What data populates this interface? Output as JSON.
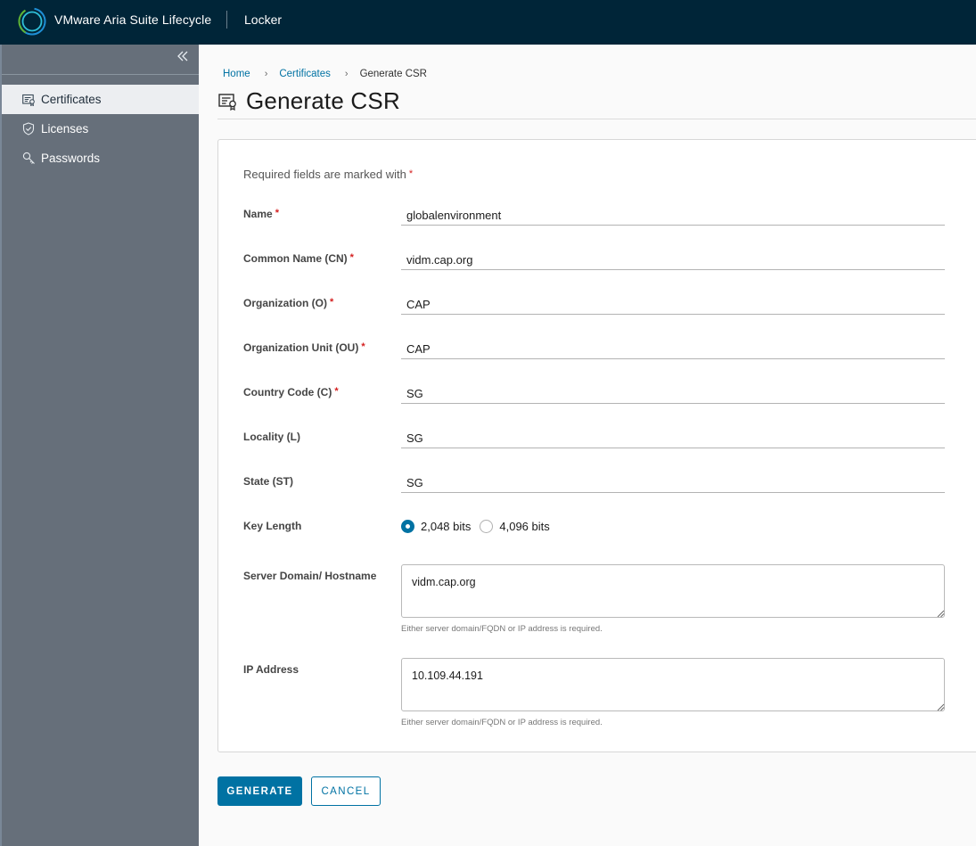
{
  "header": {
    "app_title": "VMware Aria Suite Lifecycle",
    "section": "Locker",
    "logo_icon": "vmware-aria-ring-logo"
  },
  "sidebar": {
    "collapse_glyph": "«",
    "items": [
      {
        "label": "Certificates",
        "icon": "certificate-icon",
        "active": true
      },
      {
        "label": "Licenses",
        "icon": "shield-check-icon",
        "active": false
      },
      {
        "label": "Passwords",
        "icon": "key-icon",
        "active": false
      }
    ]
  },
  "breadcrumb": {
    "items": [
      "Home",
      "Certificates",
      "Generate CSR"
    ],
    "separator": "›"
  },
  "page": {
    "title": "Generate CSR",
    "title_icon": "certificate-icon"
  },
  "form": {
    "required_note": "Required fields are marked with",
    "required_marker": "*",
    "fields": [
      {
        "label": "Name",
        "required": true,
        "value": "globalenvironment"
      },
      {
        "label": "Common Name (CN)",
        "required": true,
        "value": "vidm.cap.org"
      },
      {
        "label": "Organization (O)",
        "required": true,
        "value": "CAP"
      },
      {
        "label": "Organization Unit (OU)",
        "required": true,
        "value": "CAP"
      },
      {
        "label": "Country Code (C)",
        "required": true,
        "value": "SG"
      },
      {
        "label": "Locality (L)",
        "required": false,
        "value": "SG"
      },
      {
        "label": "State (ST)",
        "required": false,
        "value": "SG"
      }
    ],
    "key_length": {
      "label": "Key Length",
      "options": [
        {
          "label": "2,048 bits",
          "selected": true
        },
        {
          "label": "4,096 bits",
          "selected": false
        }
      ]
    },
    "server_domain": {
      "label": "Server Domain/ Hostname",
      "value": "vidm.cap.org",
      "helper": "Either server domain/FQDN or IP address is required."
    },
    "ip_address": {
      "label": "IP Address",
      "value": "10.109.44.191",
      "helper": "Either server domain/FQDN or IP address is required."
    }
  },
  "actions": {
    "generate_label": "GENERATE",
    "cancel_label": "CANCEL"
  },
  "colors": {
    "header_bg": "#002538",
    "sidebar_bg": "#666f7a",
    "accent": "#0072a3",
    "required": "#d41f1f"
  }
}
